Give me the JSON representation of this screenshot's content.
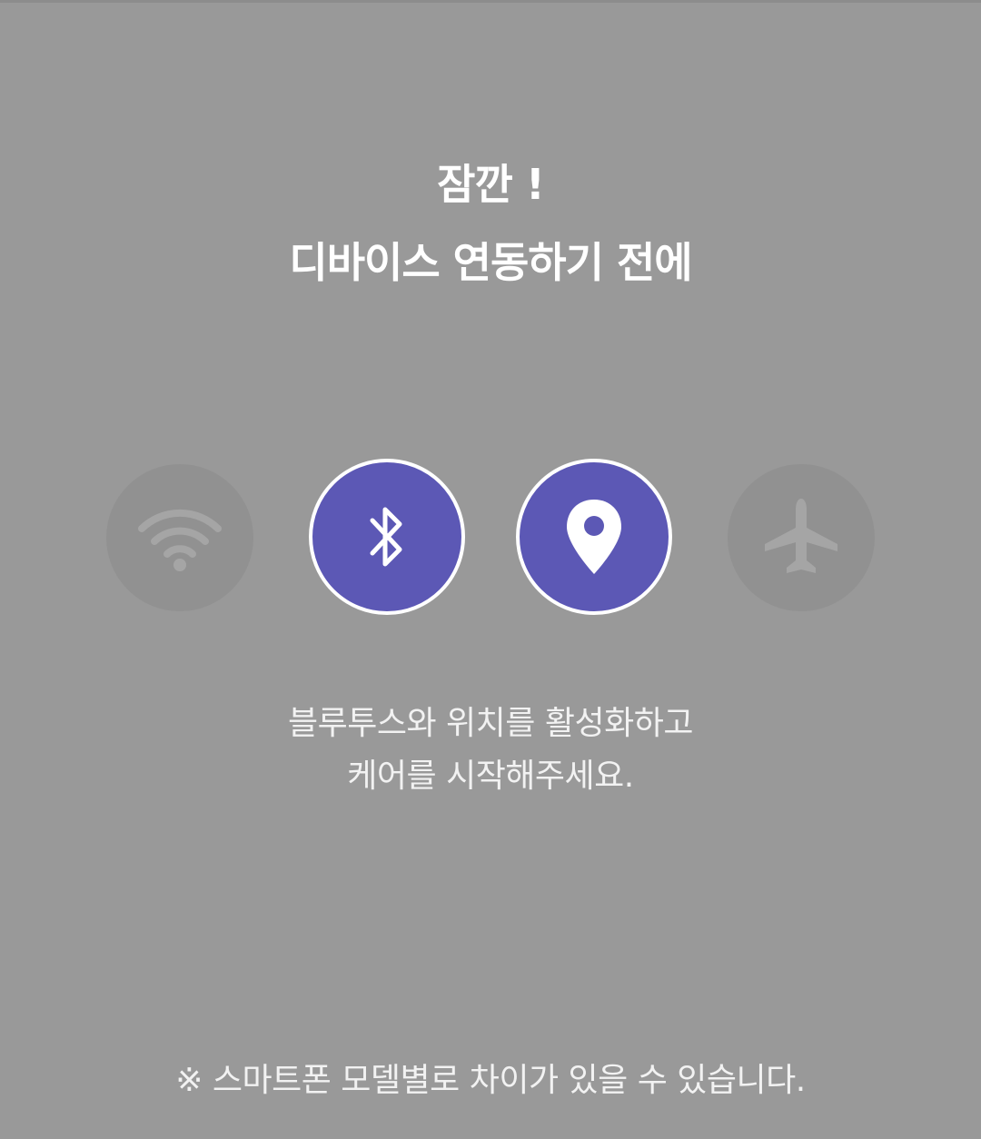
{
  "header": {
    "title_line1": "잠깐 !",
    "title_line2": "디바이스 연동하기 전에"
  },
  "icons": [
    {
      "name": "wifi-icon",
      "state": "inactive"
    },
    {
      "name": "bluetooth-icon",
      "state": "active"
    },
    {
      "name": "location-pin-icon",
      "state": "active"
    },
    {
      "name": "airplane-icon",
      "state": "inactive"
    }
  ],
  "colors": {
    "background": "#999999",
    "active_circle": "#5c58b5",
    "inactive_circle": "#919191",
    "text": "#ffffff"
  },
  "message": {
    "line1": "블루투스와 위치를 활성화하고",
    "line2": "케어를 시작해주세요."
  },
  "footnote": "※ 스마트폰 모델별로 차이가 있을 수 있습니다."
}
